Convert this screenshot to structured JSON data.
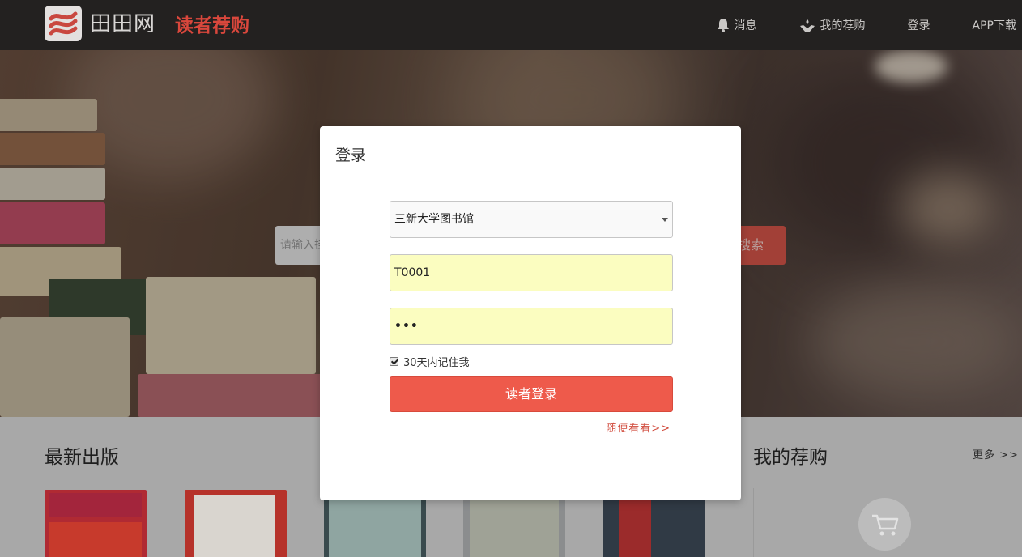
{
  "header": {
    "brand": "田田网",
    "subtitle": "读者荐购",
    "nav": [
      {
        "label": "消息",
        "icon": "bell-icon"
      },
      {
        "label": "我的荐购",
        "icon": "hand-icon"
      },
      {
        "label": "登录"
      },
      {
        "label": "APP下载"
      }
    ]
  },
  "hero": {
    "search_placeholder": "请输入挂",
    "search_button": "搜索"
  },
  "sections": {
    "latest_title": "最新出版",
    "my_recommend_title": "我的荐购",
    "more_label": "更多 >>"
  },
  "login_modal": {
    "title": "登录",
    "library_selected": "三新大学图书馆",
    "username_value": "T0001",
    "password_masked": "•••",
    "remember_label": "30天内记住我",
    "remember_checked": true,
    "login_button": "读者登录",
    "browse_link": "随便看看>>"
  },
  "colors": {
    "accent": "#ee5a4b",
    "brand_red": "#d9473c",
    "topbar": "#232120",
    "autofill_yellow": "#fbfdc0"
  }
}
